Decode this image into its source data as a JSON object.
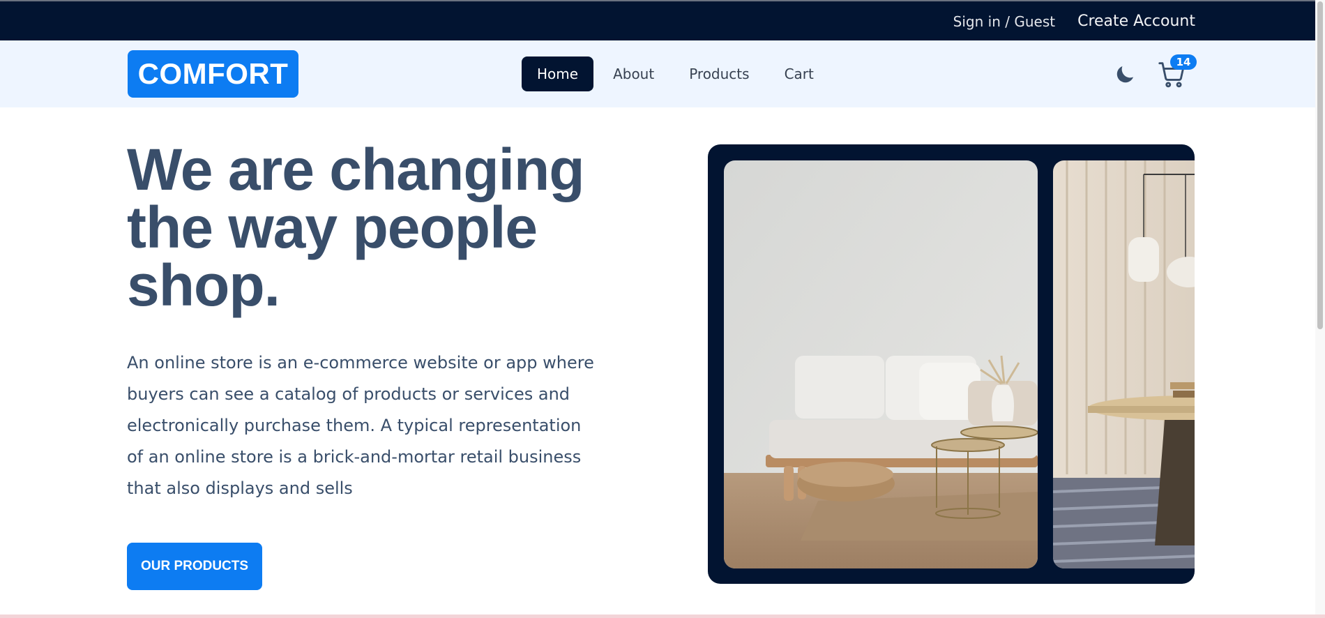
{
  "topbar": {
    "signin_label": "Sign in / Guest",
    "create_account_label": "Create Account"
  },
  "navbar": {
    "logo_text": "COMFORT",
    "links": [
      {
        "label": "Home",
        "active": true
      },
      {
        "label": "About",
        "active": false
      },
      {
        "label": "Products",
        "active": false
      },
      {
        "label": "Cart",
        "active": false
      }
    ],
    "theme_icon": "moon-icon",
    "cart_icon": "cart-icon",
    "cart_count": "14"
  },
  "hero": {
    "title": "We are changing the way people shop.",
    "description": "An online store is an e-commerce website or app where buyers can see a catalog of products or services and electronically purchase them. A typical representation of an online store is a brick-and-mortar retail business that also displays and sells",
    "cta_label": "OUR PRODUCTS"
  },
  "carousel": {
    "slides": [
      {
        "subject": "living room with white sofa, rattan pouf, rug and gold side tables"
      },
      {
        "subject": "dining area with pendant lamps, round wooden table and striped rug"
      }
    ]
  },
  "colors": {
    "topbar_bg": "#021431",
    "navbar_bg": "#eef5ff",
    "primary": "#0d7cf2",
    "heading": "#394e6a"
  }
}
